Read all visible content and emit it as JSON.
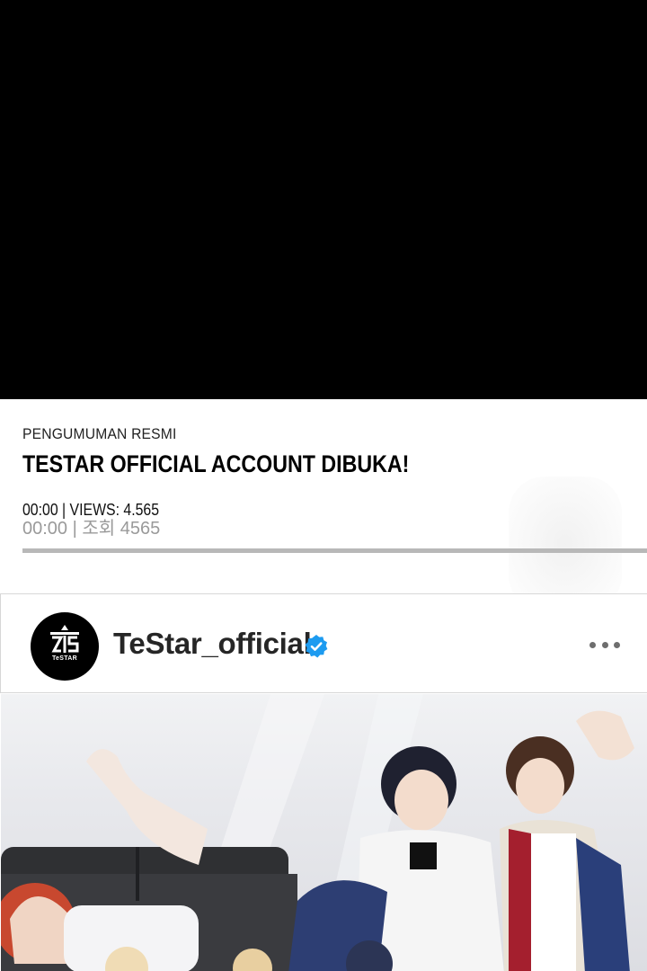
{
  "post": {
    "category": "PENGUMUMAN RESMI",
    "headline": "TESTAR OFFICIAL ACCOUNT DIBUKA!",
    "meta_translated": "00:00 | VIEWS: 4.565",
    "meta_original": "00:00 | 조회 4565"
  },
  "instagram": {
    "avatar_label": "TeSTAR",
    "handle": "TeStar_official",
    "verified": true,
    "verified_color": "#1d9bf0",
    "more_icon": "more-horizontal-icon"
  },
  "colors": {
    "video_bg": "#000000",
    "divider": "#b8b8b8"
  }
}
